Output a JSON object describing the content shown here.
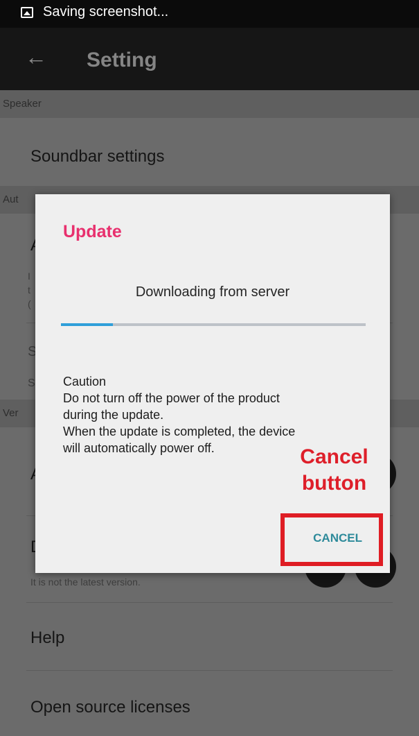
{
  "status_bar": {
    "text": "Saving screenshot...",
    "icon": "image-icon"
  },
  "app_bar": {
    "back_icon": "←",
    "title": "Setting"
  },
  "settings": {
    "speaker_header": "Speaker",
    "soundbar_settings": "Soundbar settings",
    "auto_header_partial": "Aut",
    "auto_row_partial": "A",
    "auto_desc_partial": [
      "I",
      "t",
      "("
    ],
    "row_s1_partial": "S",
    "row_s2_partial": "S",
    "version_header_partial": "Ver",
    "version_row_partial": "A",
    "download_row_partial": "D",
    "not_latest_text": "It is not the latest version.",
    "help": "Help",
    "open_source": "Open source licenses"
  },
  "dialog": {
    "title": "Update",
    "message": "Downloading from server",
    "progress_fraction": 0.17,
    "caution_lines": [
      "Caution",
      "Do not turn off the power of the product",
      "during the update.",
      "When the update is completed, the device",
      "will automatically power off."
    ],
    "cancel_label": "CANCEL"
  },
  "annotation": {
    "line1": "Cancel",
    "line2": "button",
    "color": "#df1d24"
  },
  "colors": {
    "title_accent": "#e8306e",
    "progress": "#2f9fd9",
    "cancel_text": "#2d8a9a"
  }
}
